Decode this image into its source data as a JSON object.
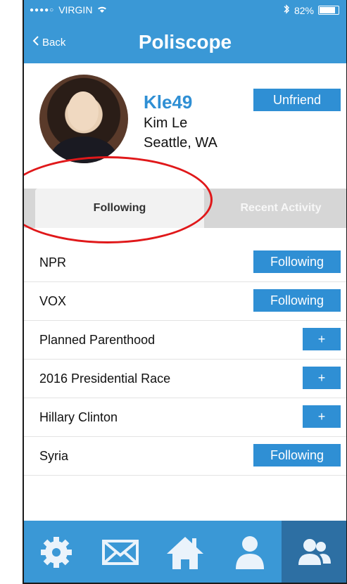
{
  "status_bar": {
    "carrier": "VIRGIN",
    "signal_dots": "●●●●○",
    "battery_percent": "82%"
  },
  "nav": {
    "back_label": "Back",
    "title": "Poliscope"
  },
  "profile": {
    "username": "Kle49",
    "real_name": "Kim Le",
    "location": "Seattle, WA",
    "unfriend_label": "Unfriend"
  },
  "tabs": {
    "following_label": "Following",
    "recent_activity_label": "Recent Activity"
  },
  "list": {
    "items": [
      {
        "label": "NPR",
        "action": "Following"
      },
      {
        "label": "VOX",
        "action": "Following"
      },
      {
        "label": "Planned Parenthood",
        "action": "+"
      },
      {
        "label": "2016 Presidential Race",
        "action": "+"
      },
      {
        "label": "Hillary Clinton",
        "action": "+"
      },
      {
        "label": "Syria",
        "action": "Following"
      }
    ]
  },
  "bottom_nav": {
    "items": [
      "gear-icon",
      "mail-icon",
      "home-icon",
      "user-icon",
      "friends-icon"
    ],
    "active": "friends-icon"
  },
  "colors": {
    "primary": "#3a98d6",
    "button": "#2f8fd4",
    "active_tab_bg": "#f2f2f2",
    "annotation_red": "#e0181a"
  }
}
